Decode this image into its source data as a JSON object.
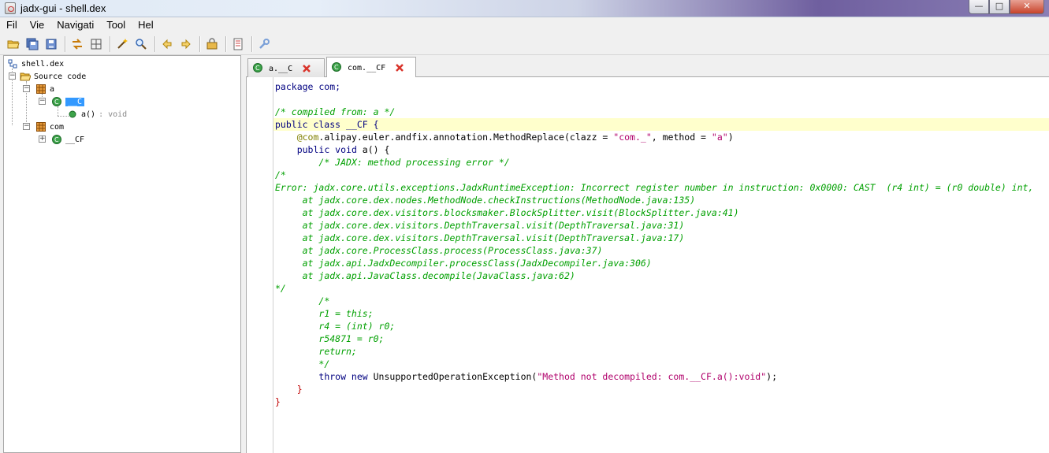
{
  "window": {
    "title": "jadx-gui - shell.dex",
    "min_label": "—",
    "max_label": "□",
    "close_label": "✕"
  },
  "menu": [
    "Fil",
    "Vie",
    "Navigati",
    "Tool",
    "Hel"
  ],
  "toolbar": {
    "icons": [
      "open-file-icon",
      "save-all-icon",
      "export-icon",
      "sync-icon",
      "flatten-packages-icon",
      "wand-icon",
      "search-icon",
      "back-icon",
      "forward-icon",
      "deobfuscation-icon",
      "log-icon",
      "settings-icon"
    ]
  },
  "tree": {
    "root": "shell.dex",
    "source": "Source code",
    "pkg_a": "a",
    "class_c": "__C",
    "method": "a()",
    "method_type": ": void",
    "pkg_com": "com",
    "class_cf": "__CF"
  },
  "tabs": [
    {
      "label": "a.__C",
      "active": false
    },
    {
      "label": "com.__CF",
      "active": true
    }
  ],
  "code": {
    "line1": "package com;",
    "line2": "",
    "line3": "/* compiled from: a */",
    "line4_kw": "public class",
    "line4_name": " __CF ",
    "line4_brace": "{",
    "line5_ann": "@com",
    "line5_rest": ".alipay.euler.andfix.annotation.MethodReplace(clazz = ",
    "line5_str1": "\"com._\"",
    "line5_mid": ", method = ",
    "line5_str2": "\"a\"",
    "line5_end": ")",
    "line6_kw": "public void",
    "line6_rest": " a() {",
    "line7": "/* JADX: method processing error */",
    "line8": "/*",
    "line9": "Error: jadx.core.utils.exceptions.JadxRuntimeException: Incorrect register number in instruction: 0x0000: CAST  (r4 int) = (r0 double) int,",
    "line10": "at jadx.core.dex.nodes.MethodNode.checkInstructions(MethodNode.java:135)",
    "line11": "at jadx.core.dex.visitors.blocksmaker.BlockSplitter.visit(BlockSplitter.java:41)",
    "line12": "at jadx.core.dex.visitors.DepthTraversal.visit(DepthTraversal.java:31)",
    "line13": "at jadx.core.dex.visitors.DepthTraversal.visit(DepthTraversal.java:17)",
    "line14": "at jadx.core.ProcessClass.process(ProcessClass.java:37)",
    "line15": "at jadx.api.JadxDecompiler.processClass(JadxDecompiler.java:306)",
    "line16": "at jadx.api.JavaClass.decompile(JavaClass.java:62)",
    "line17": "*/",
    "line18": "/*",
    "line19": "r1 = this;",
    "line20": "r4 = (int) r0;",
    "line21": "r54871 = r0;",
    "line22": "return;",
    "line23": "*/",
    "line24_kw": "throw new",
    "line24_rest": " UnsupportedOperationException(",
    "line24_str": "\"Method not decompiled: com.__CF.a():void\"",
    "line24_end": ");",
    "line25": "}",
    "line26": "}"
  },
  "colors": {
    "keyword": "#000080",
    "comment": "#008000",
    "string": "#b0006b",
    "selection": "#3399ff",
    "highlight_line": "#ffffcc"
  }
}
